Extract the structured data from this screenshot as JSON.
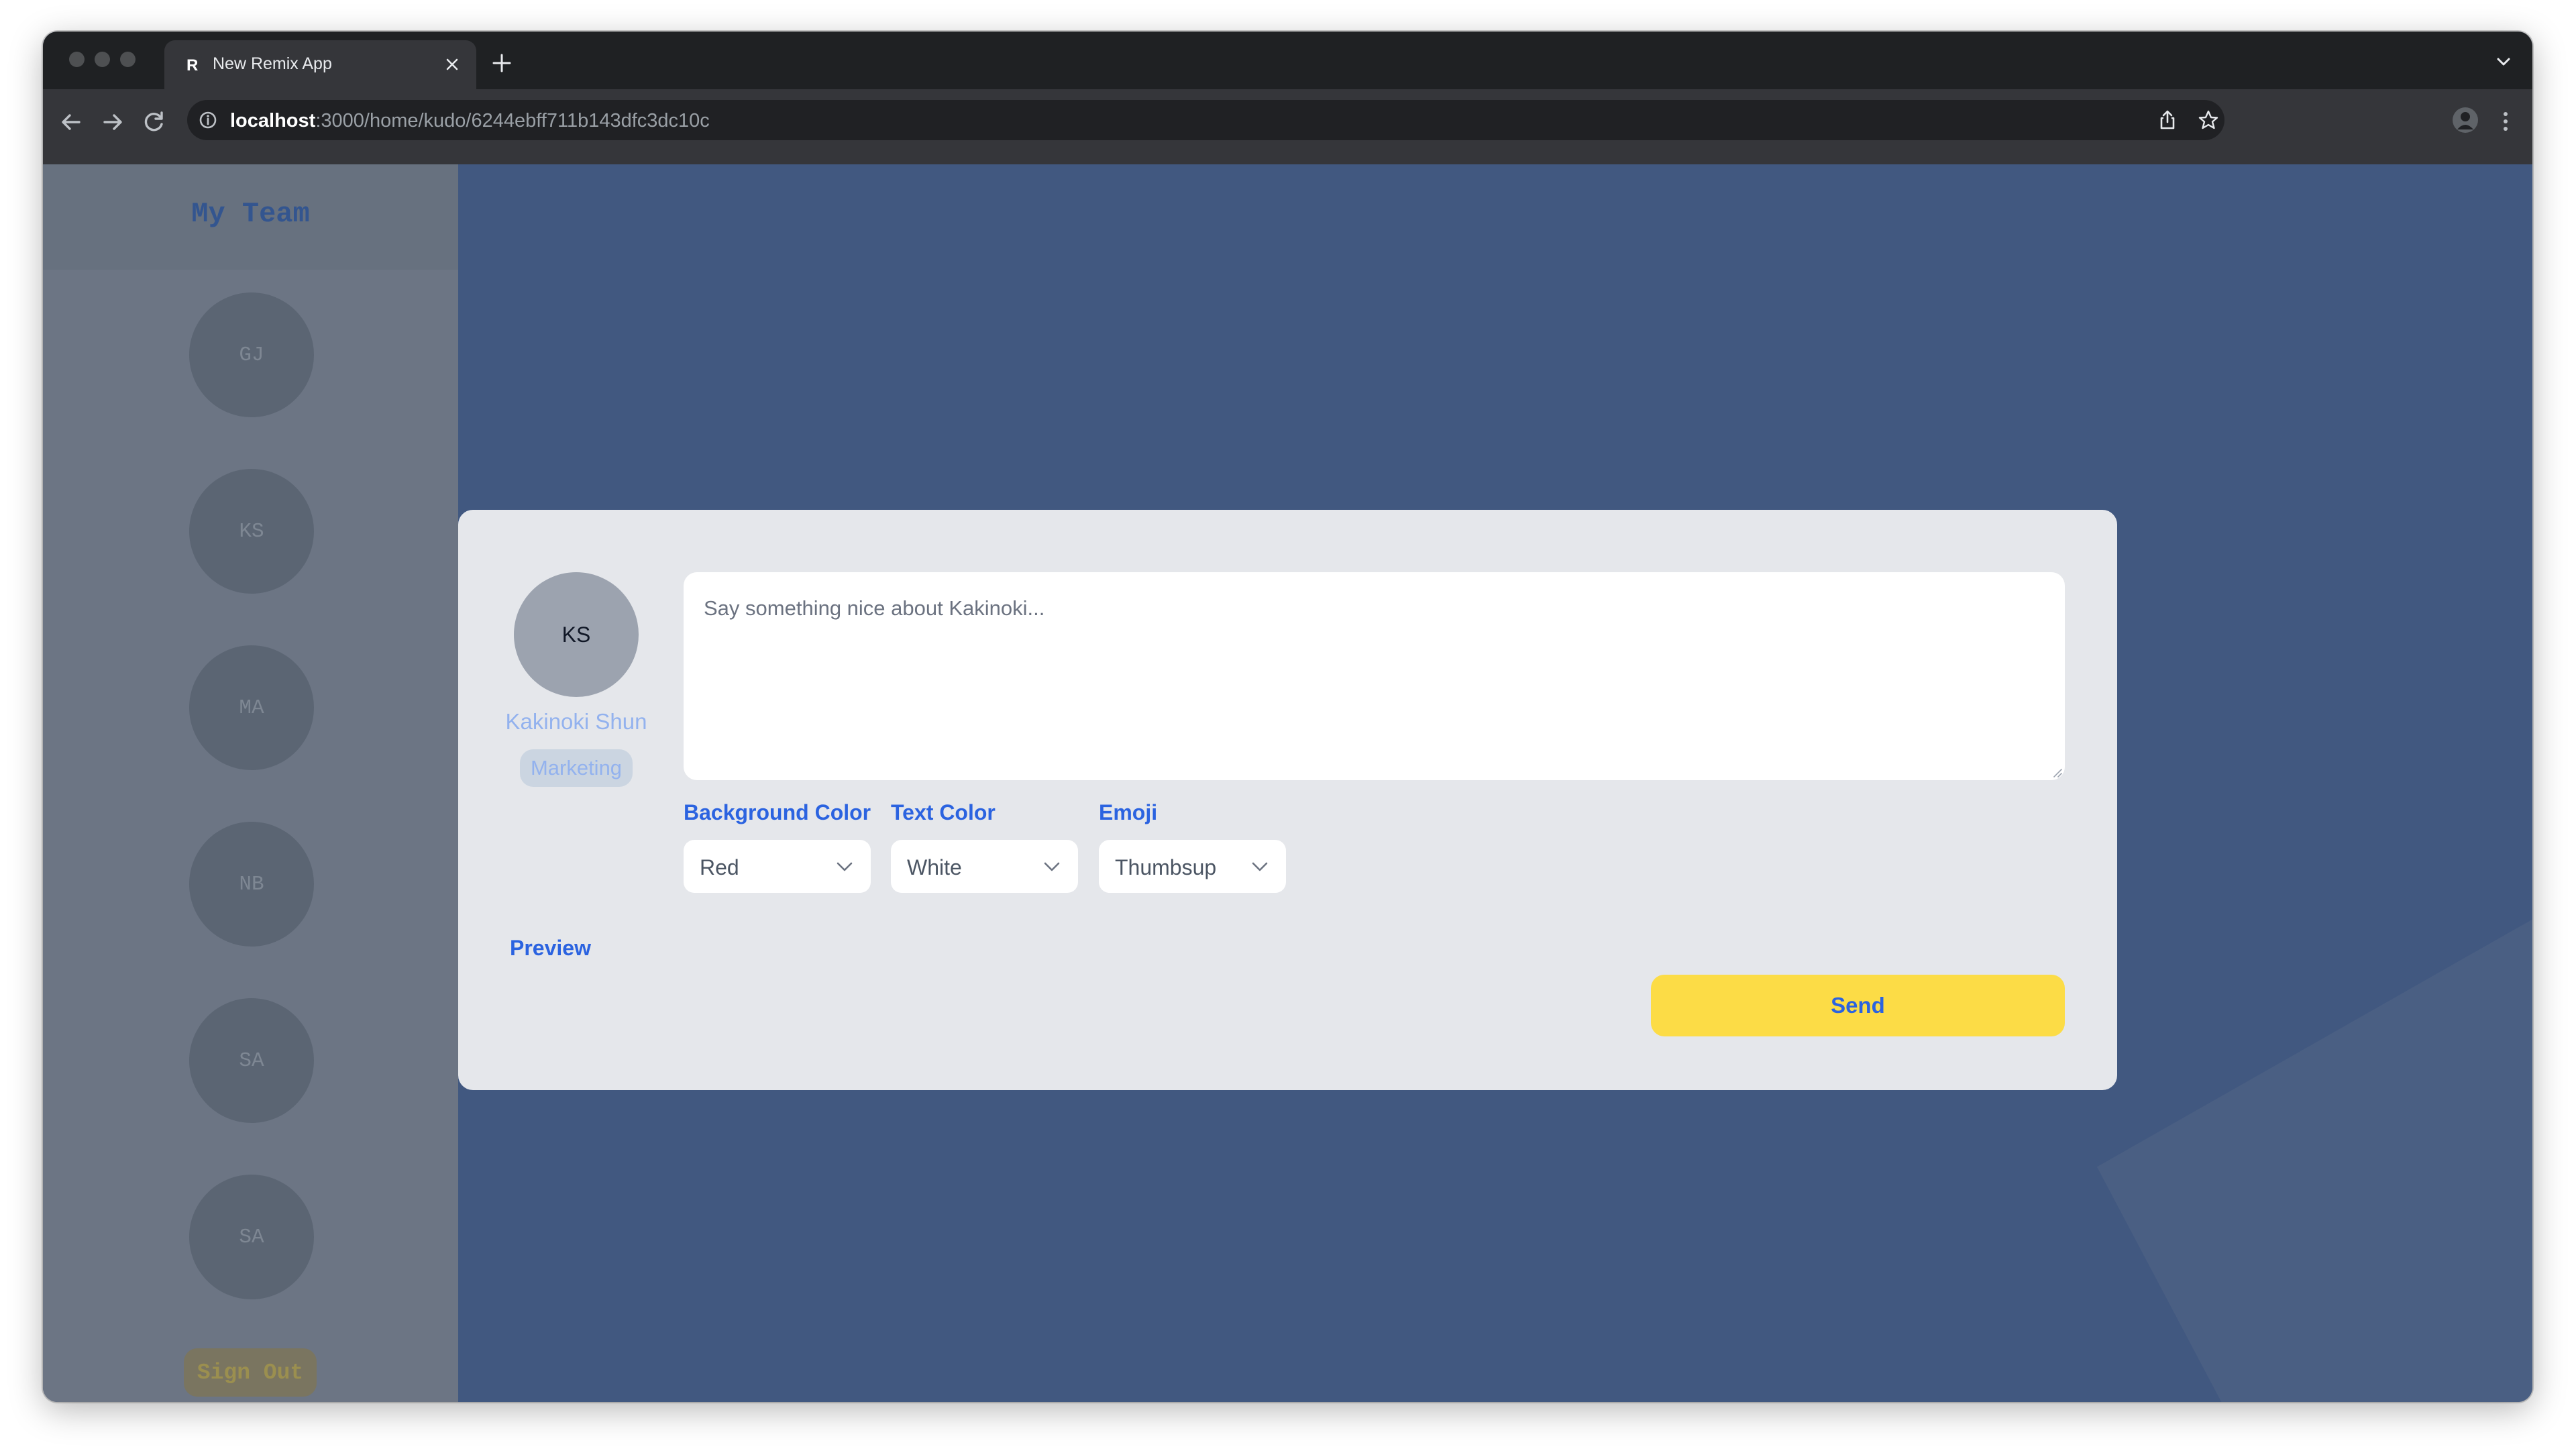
{
  "browser": {
    "tab_title": "New Remix App",
    "url_host": "localhost",
    "url_path": ":3000/home/kudo/6244ebff711b143dfc3dc10c"
  },
  "sidebar": {
    "title": "My Team",
    "members": [
      "GJ",
      "KS",
      "MA",
      "NB",
      "SA",
      "SA"
    ],
    "sign_out_label": "Sign Out"
  },
  "kudo_form": {
    "recipient": {
      "initials": "KS",
      "name": "Kakinoki Shun",
      "department": "Marketing"
    },
    "message_value": "",
    "message_placeholder": "Say something nice about Kakinoki...",
    "background_color": {
      "label": "Background Color",
      "value": "Red"
    },
    "text_color": {
      "label": "Text Color",
      "value": "White"
    },
    "emoji": {
      "label": "Emoji",
      "value": "Thumbsup"
    },
    "preview_label": "Preview",
    "send_label": "Send"
  },
  "colors": {
    "accent_blue": "#2b63e0",
    "send_yellow": "#fcdc46",
    "page_background": "#415880"
  }
}
